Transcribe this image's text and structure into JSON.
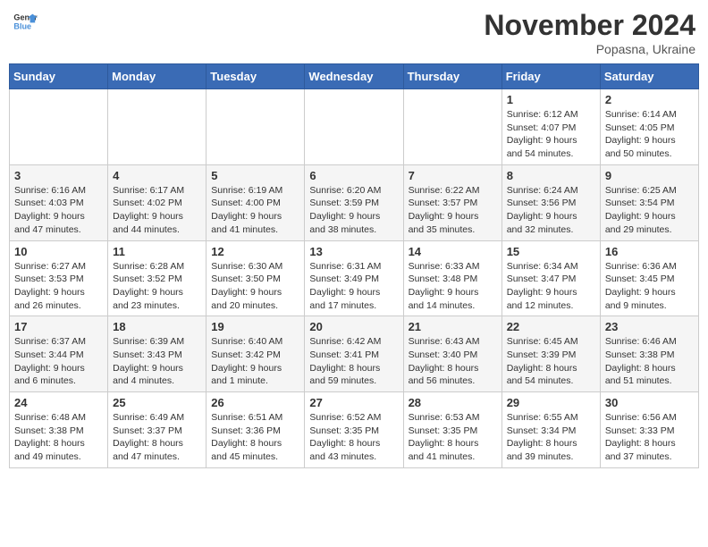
{
  "header": {
    "logo_general": "General",
    "logo_blue": "Blue",
    "month_title": "November 2024",
    "location": "Popasna, Ukraine"
  },
  "weekdays": [
    "Sunday",
    "Monday",
    "Tuesday",
    "Wednesday",
    "Thursday",
    "Friday",
    "Saturday"
  ],
  "weeks": [
    [
      {
        "day": "",
        "info": ""
      },
      {
        "day": "",
        "info": ""
      },
      {
        "day": "",
        "info": ""
      },
      {
        "day": "",
        "info": ""
      },
      {
        "day": "",
        "info": ""
      },
      {
        "day": "1",
        "info": "Sunrise: 6:12 AM\nSunset: 4:07 PM\nDaylight: 9 hours and 54 minutes."
      },
      {
        "day": "2",
        "info": "Sunrise: 6:14 AM\nSunset: 4:05 PM\nDaylight: 9 hours and 50 minutes."
      }
    ],
    [
      {
        "day": "3",
        "info": "Sunrise: 6:16 AM\nSunset: 4:03 PM\nDaylight: 9 hours and 47 minutes."
      },
      {
        "day": "4",
        "info": "Sunrise: 6:17 AM\nSunset: 4:02 PM\nDaylight: 9 hours and 44 minutes."
      },
      {
        "day": "5",
        "info": "Sunrise: 6:19 AM\nSunset: 4:00 PM\nDaylight: 9 hours and 41 minutes."
      },
      {
        "day": "6",
        "info": "Sunrise: 6:20 AM\nSunset: 3:59 PM\nDaylight: 9 hours and 38 minutes."
      },
      {
        "day": "7",
        "info": "Sunrise: 6:22 AM\nSunset: 3:57 PM\nDaylight: 9 hours and 35 minutes."
      },
      {
        "day": "8",
        "info": "Sunrise: 6:24 AM\nSunset: 3:56 PM\nDaylight: 9 hours and 32 minutes."
      },
      {
        "day": "9",
        "info": "Sunrise: 6:25 AM\nSunset: 3:54 PM\nDaylight: 9 hours and 29 minutes."
      }
    ],
    [
      {
        "day": "10",
        "info": "Sunrise: 6:27 AM\nSunset: 3:53 PM\nDaylight: 9 hours and 26 minutes."
      },
      {
        "day": "11",
        "info": "Sunrise: 6:28 AM\nSunset: 3:52 PM\nDaylight: 9 hours and 23 minutes."
      },
      {
        "day": "12",
        "info": "Sunrise: 6:30 AM\nSunset: 3:50 PM\nDaylight: 9 hours and 20 minutes."
      },
      {
        "day": "13",
        "info": "Sunrise: 6:31 AM\nSunset: 3:49 PM\nDaylight: 9 hours and 17 minutes."
      },
      {
        "day": "14",
        "info": "Sunrise: 6:33 AM\nSunset: 3:48 PM\nDaylight: 9 hours and 14 minutes."
      },
      {
        "day": "15",
        "info": "Sunrise: 6:34 AM\nSunset: 3:47 PM\nDaylight: 9 hours and 12 minutes."
      },
      {
        "day": "16",
        "info": "Sunrise: 6:36 AM\nSunset: 3:45 PM\nDaylight: 9 hours and 9 minutes."
      }
    ],
    [
      {
        "day": "17",
        "info": "Sunrise: 6:37 AM\nSunset: 3:44 PM\nDaylight: 9 hours and 6 minutes."
      },
      {
        "day": "18",
        "info": "Sunrise: 6:39 AM\nSunset: 3:43 PM\nDaylight: 9 hours and 4 minutes."
      },
      {
        "day": "19",
        "info": "Sunrise: 6:40 AM\nSunset: 3:42 PM\nDaylight: 9 hours and 1 minute."
      },
      {
        "day": "20",
        "info": "Sunrise: 6:42 AM\nSunset: 3:41 PM\nDaylight: 8 hours and 59 minutes."
      },
      {
        "day": "21",
        "info": "Sunrise: 6:43 AM\nSunset: 3:40 PM\nDaylight: 8 hours and 56 minutes."
      },
      {
        "day": "22",
        "info": "Sunrise: 6:45 AM\nSunset: 3:39 PM\nDaylight: 8 hours and 54 minutes."
      },
      {
        "day": "23",
        "info": "Sunrise: 6:46 AM\nSunset: 3:38 PM\nDaylight: 8 hours and 51 minutes."
      }
    ],
    [
      {
        "day": "24",
        "info": "Sunrise: 6:48 AM\nSunset: 3:38 PM\nDaylight: 8 hours and 49 minutes."
      },
      {
        "day": "25",
        "info": "Sunrise: 6:49 AM\nSunset: 3:37 PM\nDaylight: 8 hours and 47 minutes."
      },
      {
        "day": "26",
        "info": "Sunrise: 6:51 AM\nSunset: 3:36 PM\nDaylight: 8 hours and 45 minutes."
      },
      {
        "day": "27",
        "info": "Sunrise: 6:52 AM\nSunset: 3:35 PM\nDaylight: 8 hours and 43 minutes."
      },
      {
        "day": "28",
        "info": "Sunrise: 6:53 AM\nSunset: 3:35 PM\nDaylight: 8 hours and 41 minutes."
      },
      {
        "day": "29",
        "info": "Sunrise: 6:55 AM\nSunset: 3:34 PM\nDaylight: 8 hours and 39 minutes."
      },
      {
        "day": "30",
        "info": "Sunrise: 6:56 AM\nSunset: 3:33 PM\nDaylight: 8 hours and 37 minutes."
      }
    ]
  ]
}
